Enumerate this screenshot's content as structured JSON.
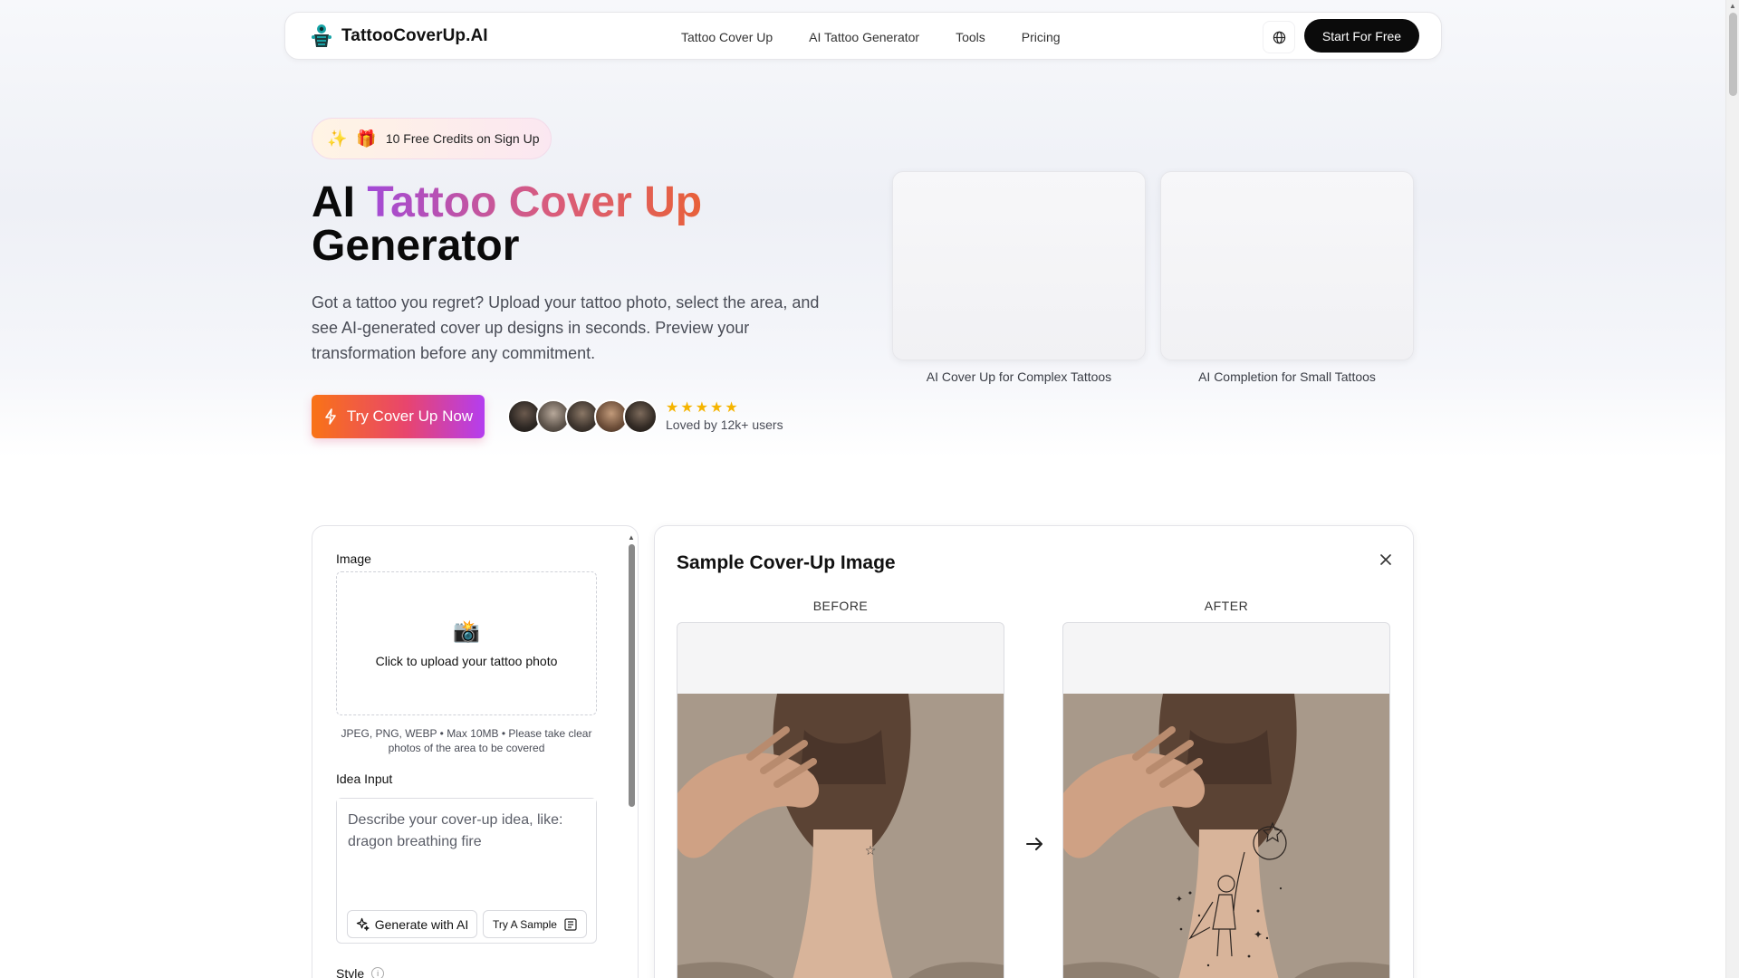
{
  "nav": {
    "brand": "TattooCoverUp.AI",
    "links": [
      "Tattoo Cover Up",
      "AI Tattoo Generator",
      "Tools",
      "Pricing"
    ],
    "cta": "Start For Free"
  },
  "hero": {
    "badge_sparkle": "✨",
    "badge_gift": "🎁",
    "badge_text": "10 Free Credits on Sign Up",
    "title_ai": "AI",
    "title_gradient": "Tattoo Cover Up",
    "title_rest": "Generator",
    "description": "Got a tattoo you regret? Upload your tattoo photo, select the area, and see AI-generated cover up designs in seconds. Preview your transformation before any commitment.",
    "cta": "Try Cover Up Now",
    "rating_stars": 5,
    "loved_text": "Loved by 12k+ users",
    "cards": [
      {
        "label": "AI Cover Up for Complex Tattoos"
      },
      {
        "label": "AI Completion for Small Tattoos"
      }
    ]
  },
  "tool": {
    "image_label": "Image",
    "upload_icon": "📸",
    "upload_text": "Click to upload your tattoo photo",
    "upload_hint": "JPEG, PNG, WEBP • Max 10MB • Please take clear photos of the area to be covered",
    "idea_label": "Idea Input",
    "idea_placeholder": "Describe your cover-up idea, like: dragon breathing fire",
    "generate_btn": "Generate with AI",
    "sample_btn": "Try A Sample",
    "style_label": "Style"
  },
  "sample": {
    "title": "Sample Cover-Up Image",
    "before_label": "BEFORE",
    "after_label": "AFTER"
  },
  "colors": {
    "accent_orange": "#f97316",
    "accent_pink": "#e8456e",
    "accent_purple": "#b43df0",
    "star": "#f5b400"
  }
}
